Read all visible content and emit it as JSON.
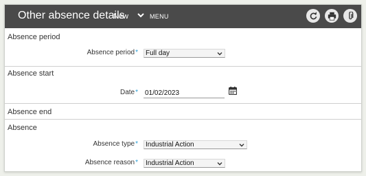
{
  "header": {
    "title": "Other absence details",
    "status": "New",
    "menu_label": "MENU",
    "actions": [
      {
        "icon": "refresh-icon"
      },
      {
        "icon": "print-icon"
      },
      {
        "icon": "paperclip-icon"
      }
    ]
  },
  "sections": {
    "absence_period": {
      "title": "Absence period",
      "field_label": "Absence period",
      "field_value": "Full day"
    },
    "absence_start": {
      "title": "Absence start",
      "field_label": "Date",
      "field_value": "01/02/2023"
    },
    "absence_end": {
      "title": "Absence end"
    },
    "absence": {
      "title": "Absence",
      "type_label": "Absence type",
      "type_value": "Industrial Action",
      "reason_label": "Absence reason",
      "reason_value": "Industrial Action"
    }
  },
  "required_marker": "*",
  "colors": {
    "header_bg": "#4a4a4a",
    "required": "#2a9fd6"
  }
}
